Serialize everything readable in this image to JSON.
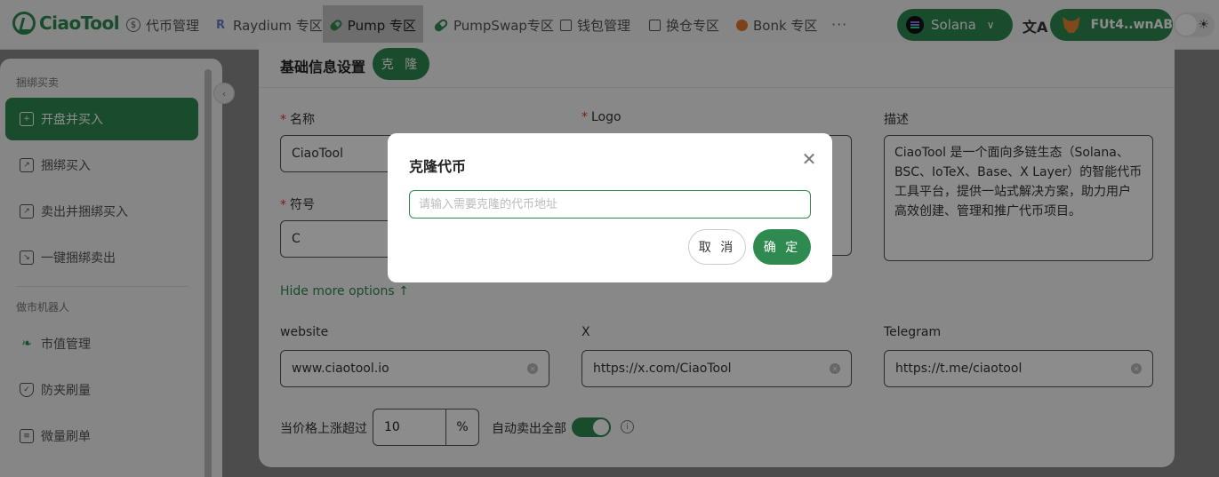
{
  "brand": {
    "name": "CiaoTool",
    "accent": "#2f8a50"
  },
  "nav": {
    "items": [
      {
        "label": "代币管理",
        "icon": "dollar-circle-icon"
      },
      {
        "label": "Raydium 专区",
        "icon": "raydium-icon"
      },
      {
        "label": "Pump 专区",
        "icon": "pill-icon"
      },
      {
        "label": "PumpSwap专区",
        "icon": "pill-icon"
      },
      {
        "label": "钱包管理",
        "icon": "wallet-icon"
      },
      {
        "label": "换仓专区",
        "icon": "swap-icon"
      },
      {
        "label": "Bonk 专区",
        "icon": "bonk-icon"
      }
    ],
    "more": "···",
    "chain": "Solana",
    "wallet": "FUt4..wnAB"
  },
  "sidebar": {
    "group1": "捆绑买卖",
    "group2": "做市机器人",
    "items": [
      {
        "label": "开盘并买入"
      },
      {
        "label": "捆绑买入"
      },
      {
        "label": "卖出并捆绑买入"
      },
      {
        "label": "一键捆绑卖出"
      },
      {
        "label": "市值管理"
      },
      {
        "label": "防夹刷量"
      },
      {
        "label": "微量刷单"
      }
    ]
  },
  "main": {
    "section_title": "基础信息设置",
    "clone_label": "克 隆",
    "name_label": "名称",
    "name_value": "CiaoTool",
    "logo_label": "Logo",
    "desc_label": "描述",
    "desc_value": "CiaoTool 是一个面向多链生态（Solana、BSC、IoTeX、Base、X Layer）的智能代币工具平台，提供一站式解决方案，助力用户高效创建、管理和推广代币项目。",
    "symbol_label": "符号",
    "symbol_value": "C",
    "hide_more": "Hide more options ↑",
    "website_label": "website",
    "website_value": "www.ciaotool.io",
    "x_label": "X",
    "x_value": "https://x.com/CiaoTool",
    "telegram_label": "Telegram",
    "telegram_value": "https://t.me/ciaotool",
    "price_label": "当价格上涨超过",
    "price_value": "10",
    "price_unit": "%",
    "auto_sell_label": "自动卖出全部",
    "auto_sell_on": true
  },
  "dialog": {
    "title": "克隆代币",
    "placeholder": "请输入需要克隆的代币地址",
    "cancel": "取 消",
    "ok": "确 定"
  }
}
